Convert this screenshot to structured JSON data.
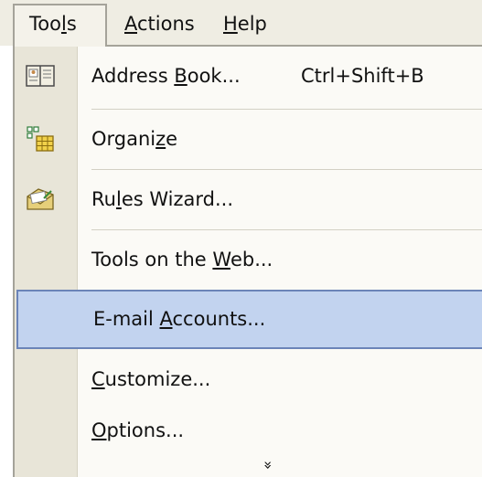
{
  "menubar": {
    "tools": "Tools",
    "tools_prefix": "Too",
    "tools_mnemonic": "l",
    "tools_suffix": "s",
    "actions_mnemonic": "A",
    "actions_suffix": "ctions",
    "help_mnemonic": "H",
    "help_suffix": "elp"
  },
  "menu": {
    "address_book": {
      "prefix": "Address ",
      "mnemonic": "B",
      "suffix": "ook...",
      "shortcut": "Ctrl+Shift+B",
      "icon": "address-book-icon"
    },
    "organize": {
      "prefix": "Organi",
      "mnemonic": "z",
      "suffix": "e",
      "icon": "organize-icon"
    },
    "rules_wizard": {
      "prefix": "Ru",
      "mnemonic": "l",
      "suffix": "es Wizard...",
      "icon": "rules-wizard-icon"
    },
    "tools_on_web": {
      "prefix": "Tools on the ",
      "mnemonic": "W",
      "suffix": "eb..."
    },
    "email_accounts": {
      "prefix": "E-mail ",
      "mnemonic": "A",
      "suffix": "ccounts..."
    },
    "customize": {
      "prefix": "",
      "mnemonic": "C",
      "suffix": "ustomize..."
    },
    "options": {
      "prefix": "",
      "mnemonic": "O",
      "suffix": "ptions..."
    },
    "expand_glyph": "»"
  },
  "colors": {
    "menubar_bg": "#efede3",
    "gutter_bg": "#e8e5d8",
    "highlight_bg": "#c2d3ef",
    "highlight_border": "#6b84b8"
  }
}
